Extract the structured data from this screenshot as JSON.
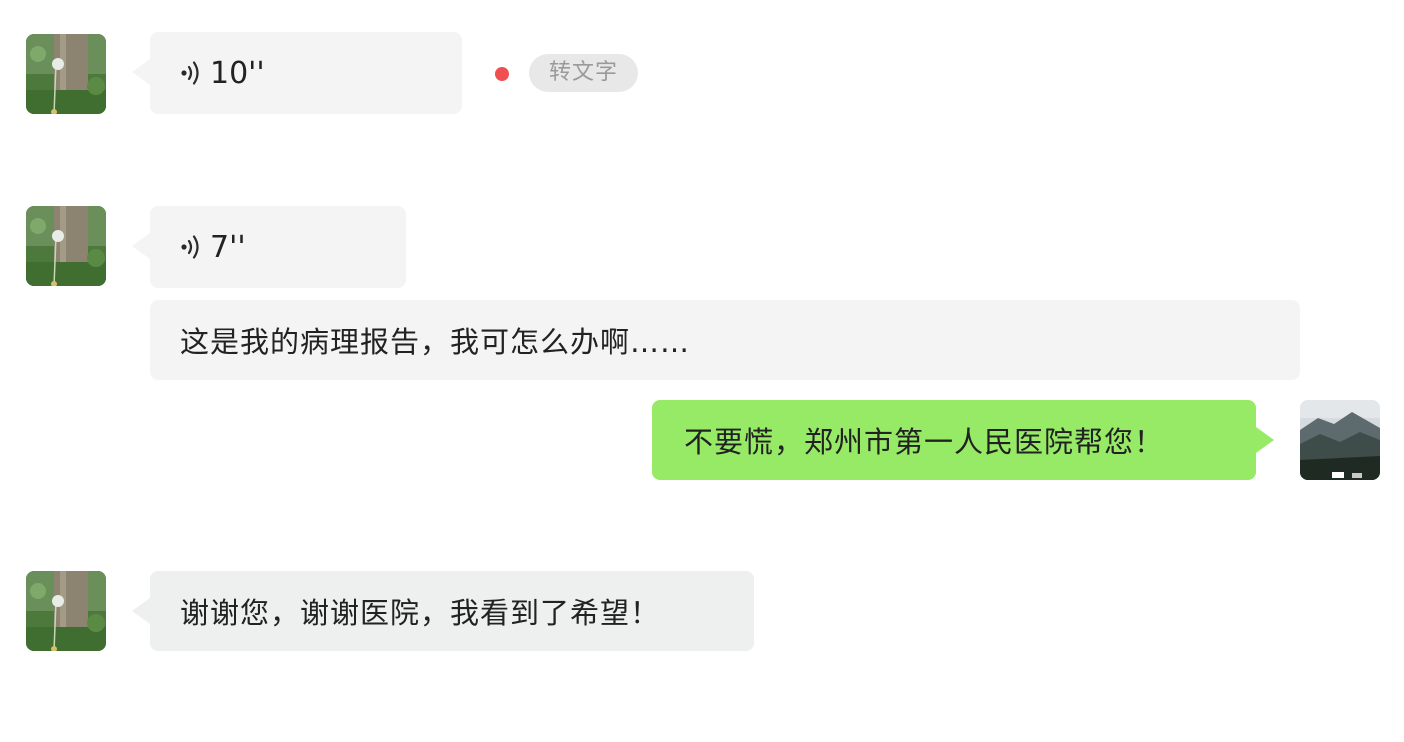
{
  "messages": [
    {
      "sender": "contact",
      "type": "voice",
      "duration": "10''",
      "unread": true,
      "transcribe_label": "转文字"
    },
    {
      "sender": "contact",
      "type": "voice",
      "duration": "7''"
    },
    {
      "sender": "contact",
      "type": "text",
      "text": "这是我的病理报告，我可怎么办啊……"
    },
    {
      "sender": "me",
      "type": "text",
      "text": "不要慌，郑州市第一人民医院帮您！"
    },
    {
      "sender": "contact",
      "type": "text",
      "text": "谢谢您，谢谢医院，我看到了希望！"
    }
  ],
  "icons": {
    "voice": "voice-wave-icon",
    "contact_avatar": "dandelion-photo",
    "my_avatar": "mountain-photo"
  },
  "colors": {
    "incoming_bubble": "#f4f4f4",
    "outgoing_bubble": "#96ea66",
    "unread_dot": "#f04f4f",
    "transcribe_pill": "#e8e8e8"
  }
}
